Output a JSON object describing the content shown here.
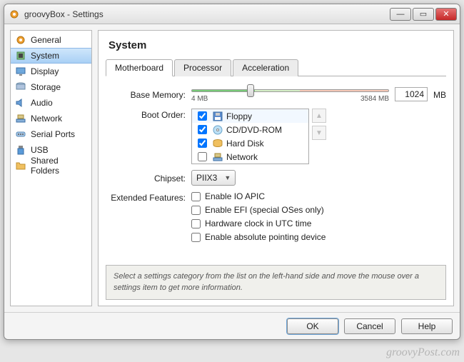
{
  "window": {
    "title": "groovyBox - Settings"
  },
  "sidebar": {
    "items": [
      {
        "label": "General",
        "icon": "gear"
      },
      {
        "label": "System",
        "icon": "chip",
        "selected": true
      },
      {
        "label": "Display",
        "icon": "monitor"
      },
      {
        "label": "Storage",
        "icon": "disk"
      },
      {
        "label": "Audio",
        "icon": "speaker"
      },
      {
        "label": "Network",
        "icon": "network"
      },
      {
        "label": "Serial Ports",
        "icon": "serial"
      },
      {
        "label": "USB",
        "icon": "usb"
      },
      {
        "label": "Shared Folders",
        "icon": "folder"
      }
    ]
  },
  "main": {
    "heading": "System",
    "tabs": [
      {
        "label": "Motherboard",
        "active": true
      },
      {
        "label": "Processor"
      },
      {
        "label": "Acceleration"
      }
    ],
    "base_memory": {
      "label": "Base Memory:",
      "value": "1024",
      "unit": "MB",
      "min_label": "4 MB",
      "max_label": "3584 MB"
    },
    "boot_order": {
      "label": "Boot Order:",
      "items": [
        {
          "label": "Floppy",
          "checked": true,
          "selected": true
        },
        {
          "label": "CD/DVD-ROM",
          "checked": true
        },
        {
          "label": "Hard Disk",
          "checked": true
        },
        {
          "label": "Network",
          "checked": false
        }
      ]
    },
    "chipset": {
      "label": "Chipset:",
      "value": "PIIX3"
    },
    "extended": {
      "label": "Extended Features:",
      "options": [
        {
          "label": "Enable IO APIC",
          "checked": false
        },
        {
          "label": "Enable EFI (special OSes only)",
          "checked": false
        },
        {
          "label": "Hardware clock in UTC time",
          "checked": false
        },
        {
          "label": "Enable absolute pointing device",
          "checked": false
        }
      ]
    },
    "hint": "Select a settings category from the list on the left-hand side and move the mouse over a settings item to get more information."
  },
  "footer": {
    "ok": "OK",
    "cancel": "Cancel",
    "help": "Help"
  },
  "watermark": "groovyPost.com"
}
